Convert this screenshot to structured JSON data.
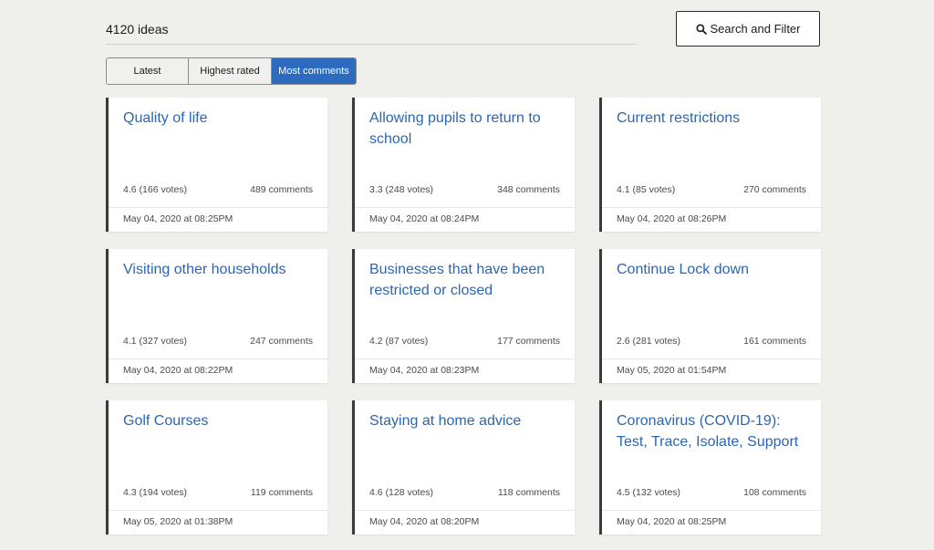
{
  "header": {
    "count_label": "4120 ideas",
    "search_label": "Search and Filter"
  },
  "tabs": [
    {
      "label": "Latest"
    },
    {
      "label": "Highest rated"
    },
    {
      "label": "Most comments"
    }
  ],
  "cards": [
    {
      "title": "Quality of life",
      "rating": "4.6 (166 votes)",
      "comments": "489 comments",
      "date": "May 04, 2020 at 08:25PM"
    },
    {
      "title": "Allowing pupils to return to school",
      "rating": "3.3 (248 votes)",
      "comments": "348 comments",
      "date": "May 04, 2020 at 08:24PM"
    },
    {
      "title": "Current restrictions",
      "rating": "4.1 (85 votes)",
      "comments": "270 comments",
      "date": "May 04, 2020 at 08:26PM"
    },
    {
      "title": "Visiting other households",
      "rating": "4.1 (327 votes)",
      "comments": "247 comments",
      "date": "May 04, 2020 at 08:22PM"
    },
    {
      "title": "Businesses that have been restricted or closed",
      "rating": "4.2 (87 votes)",
      "comments": "177 comments",
      "date": "May 04, 2020 at 08:23PM"
    },
    {
      "title": "Continue Lock down",
      "rating": "2.6 (281 votes)",
      "comments": "161 comments",
      "date": "May 05, 2020 at 01:54PM"
    },
    {
      "title": "Golf Courses",
      "rating": "4.3 (194 votes)",
      "comments": "119 comments",
      "date": "May 05, 2020 at 01:38PM"
    },
    {
      "title": "Staying at home advice",
      "rating": "4.6 (128 votes)",
      "comments": "118 comments",
      "date": "May 04, 2020 at 08:20PM"
    },
    {
      "title": "Coronavirus (COVID-19): Test, Trace, Isolate, Support",
      "rating": "4.5 (132 votes)",
      "comments": "108 comments",
      "date": "May 04, 2020 at 08:25PM"
    }
  ],
  "theme": {
    "accent": "#2d6bbf",
    "link": "#2b66b3",
    "card_border": "#3a3a3a",
    "background": "#efefec"
  }
}
